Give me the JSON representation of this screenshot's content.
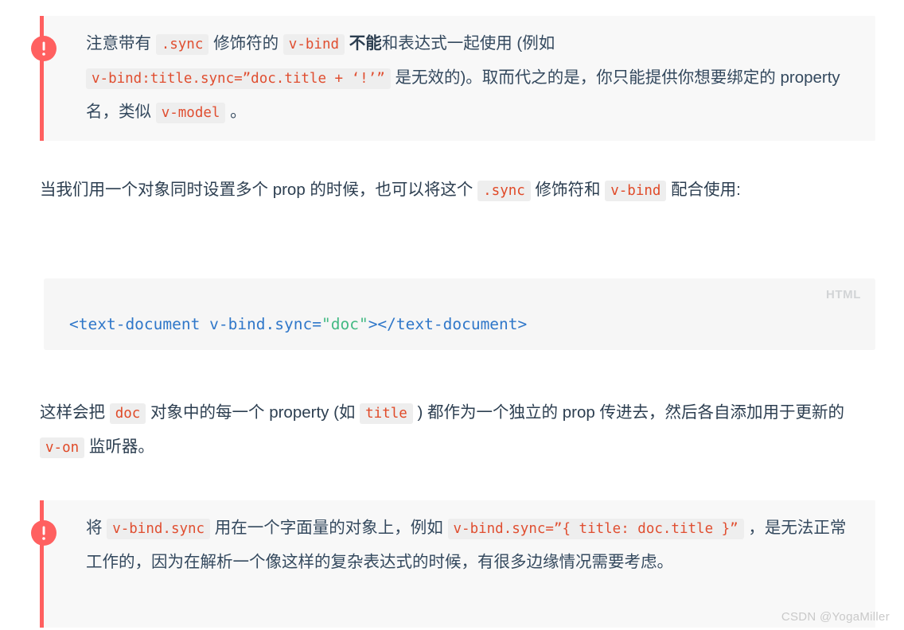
{
  "colors": {
    "accent_red": "#ff6060",
    "inline_code_text": "#e04e30",
    "inline_code_bg": "#eeeeee",
    "callout_bg": "#f8f8f8",
    "code_block_bg": "#f6f6f6",
    "code_tag": "#2f77c9",
    "code_string": "#42b983",
    "body_text": "#2c3e50",
    "lang_label": "#d2d4d6",
    "watermark": "#c9c9c9"
  },
  "callout_top": {
    "icon_name": "warning-exclamation-icon",
    "segments": [
      {
        "type": "text",
        "value": "注意带有 "
      },
      {
        "type": "code",
        "value": ".sync"
      },
      {
        "type": "text",
        "value": " 修饰符的 "
      },
      {
        "type": "code",
        "value": "v-bind"
      },
      {
        "type": "text",
        "value": " "
      },
      {
        "type": "bold",
        "value": "不能"
      },
      {
        "type": "text",
        "value": "和表达式一起使用 (例如 "
      },
      {
        "type": "code",
        "value": "v-bind:title.sync=”doc.title + ‘!’”"
      },
      {
        "type": "text",
        "value": " 是无效的)。取而代之的是，你只能提供你想要绑定的 property 名，类似 "
      },
      {
        "type": "code",
        "value": "v-model"
      },
      {
        "type": "text",
        "value": " 。"
      }
    ]
  },
  "paragraph_1": {
    "segments": [
      {
        "type": "text",
        "value": "当我们用一个对象同时设置多个 prop 的时候，也可以将这个 "
      },
      {
        "type": "code",
        "value": ".sync"
      },
      {
        "type": "text",
        "value": " 修饰符和 "
      },
      {
        "type": "code",
        "value": "v-bind"
      },
      {
        "type": "text",
        "value": " 配合使用:"
      }
    ]
  },
  "code_block": {
    "language_label": "HTML",
    "tokens": [
      {
        "type": "tag",
        "value": "<text-document v-bind.sync="
      },
      {
        "type": "string",
        "value": "\"doc\""
      },
      {
        "type": "tag",
        "value": "></text-document>"
      }
    ]
  },
  "paragraph_2": {
    "segments": [
      {
        "type": "text",
        "value": "这样会把 "
      },
      {
        "type": "code",
        "value": "doc"
      },
      {
        "type": "text",
        "value": " 对象中的每一个 property (如 "
      },
      {
        "type": "code",
        "value": "title"
      },
      {
        "type": "text",
        "value": " ) 都作为一个独立的 prop 传进去，然后各自添加用于更新的 "
      },
      {
        "type": "code",
        "value": "v-on"
      },
      {
        "type": "text",
        "value": " 监听器。"
      }
    ]
  },
  "callout_bottom": {
    "icon_name": "warning-exclamation-icon",
    "segments": [
      {
        "type": "text",
        "value": "将 "
      },
      {
        "type": "code",
        "value": "v-bind.sync"
      },
      {
        "type": "text",
        "value": " 用在一个字面量的对象上，例如 "
      },
      {
        "type": "code",
        "value": "v-bind.sync=”{ title: doc.title }”"
      },
      {
        "type": "text",
        "value": " ，是无法正常工作的，因为在解析一个像这样的复杂表达式的时候，有很多边缘情况需要考虑。"
      }
    ]
  },
  "watermark": {
    "text": "CSDN @YogaMiller"
  }
}
